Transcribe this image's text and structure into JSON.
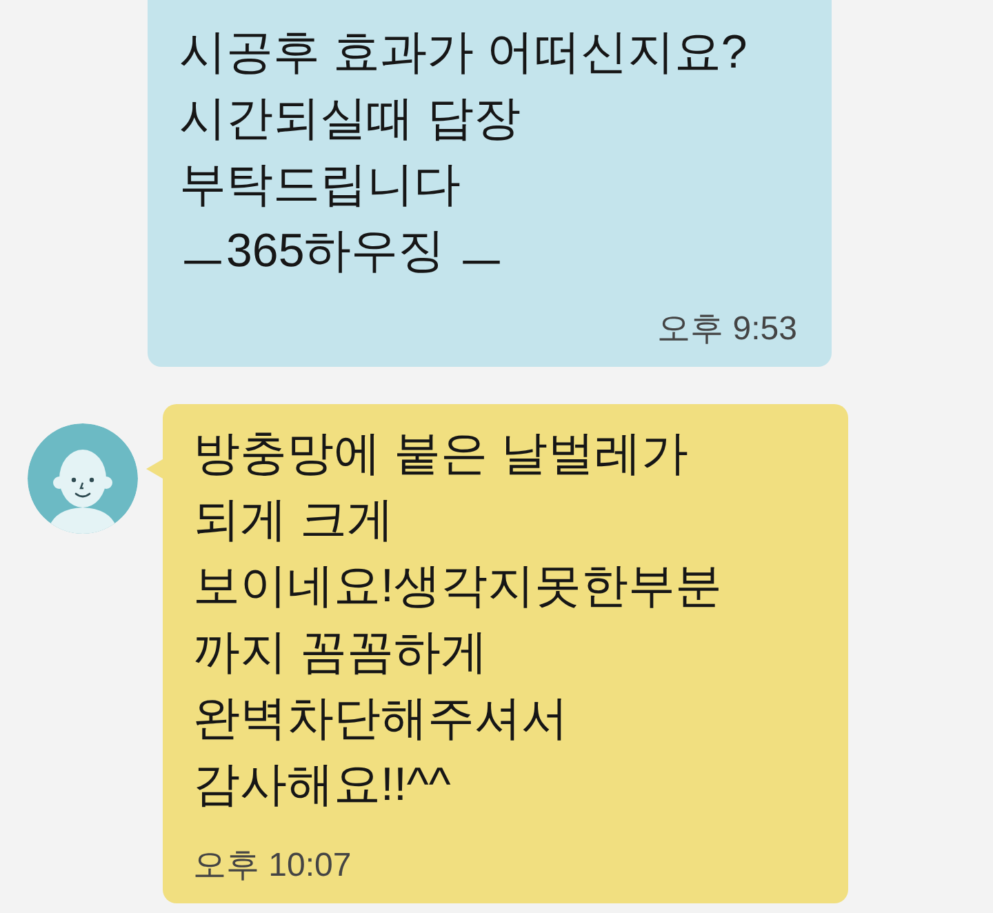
{
  "messages": [
    {
      "kind": "sent",
      "text": "시공후 효과가 어떠신지요?\n시간되실때 답장\n부탁드립니다\nㅡ365하우징 ㅡ",
      "time": "오후 9:53"
    },
    {
      "kind": "received",
      "text": "방충망에 붙은 날벌레가\n되게 크게\n보이네요!생각지못한부분\n까지 꼼꼼하게\n완벽차단해주셔서\n감사해요!!^^",
      "time": "오후 10:07"
    }
  ]
}
